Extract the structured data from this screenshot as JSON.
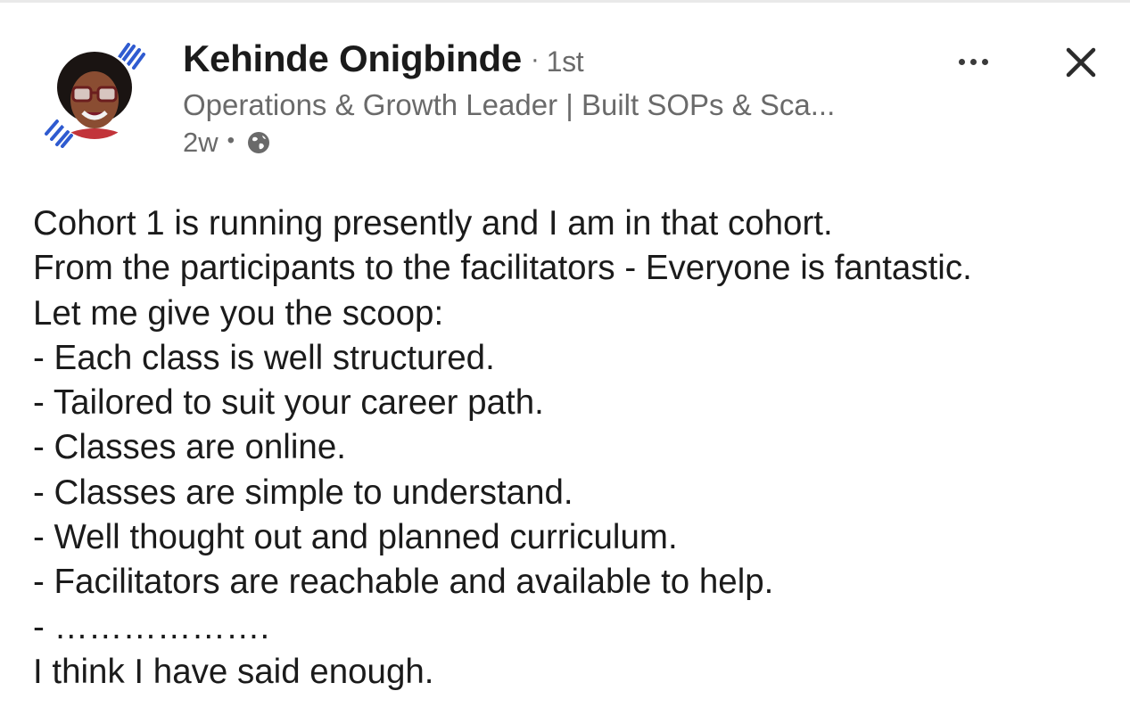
{
  "author": {
    "name": "Kehinde Onigbinde",
    "separator": "·",
    "degree": "1st",
    "headline": "Operations & Growth Leader | Built SOPs & Sca...",
    "age": "2w",
    "meta_separator": "•",
    "visibility_icon": "globe-icon",
    "avatar_icon": "profile-photo"
  },
  "actions": {
    "more_icon": "more-horizontal-icon",
    "close_icon": "close-icon"
  },
  "post": {
    "lines": [
      "Cohort 1 is running presently and I am in that cohort.",
      "From the participants to the facilitators - Everyone is fantastic.",
      "Let me give you the scoop:",
      "- Each class is well structured.",
      "- Tailored to suit your career path.",
      "- Classes are online.",
      "- Classes are simple to understand.",
      "- Well thought out and planned curriculum.",
      "- Facilitators are reachable and available to help.",
      "- ……………….",
      "I think I have said enough."
    ]
  },
  "colors": {
    "text_primary": "#1b1b1b",
    "text_secondary": "#6a6a6a",
    "avatar_accent": "#2f5bd0",
    "background": "#ffffff"
  }
}
